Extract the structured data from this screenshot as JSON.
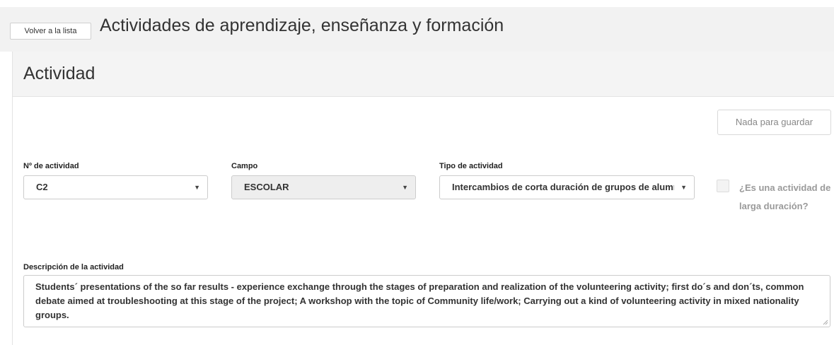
{
  "header": {
    "back_label": "Volver a la lista",
    "title": "Actividades de aprendizaje, enseñanza y formación"
  },
  "panel": {
    "title": "Actividad",
    "save_label": "Nada para guardar"
  },
  "fields": {
    "activity_number": {
      "label": "Nº de actividad",
      "value": "C2"
    },
    "campo": {
      "label": "Campo",
      "value": "ESCOLAR"
    },
    "tipo": {
      "label": "Tipo de actividad",
      "value": "Intercambios de corta duración de grupos de alumnos"
    },
    "long_duration": {
      "label": "¿Es una actividad de larga duración?",
      "checked": false
    },
    "description": {
      "label": "Descripción de la actividad",
      "value": "Students´ presentations of the so far results - experience exchange through the stages of preparation and realization of the volunteering activity; first do´s and don´ts, common debate aimed at troubleshooting at this stage of the project; A workshop with the topic of Community life/work; Carrying out a kind of volunteering activity in mixed nationality groups."
    }
  },
  "colors": {
    "topbar_bg": "#f2f2f2",
    "panel_header_bg": "#f4f4f4",
    "disabled_bg": "#eeeeee",
    "muted_text": "#9a9a9a"
  },
  "icons": {
    "caret": "caret-down-icon",
    "resize": "resize-grip-icon"
  }
}
